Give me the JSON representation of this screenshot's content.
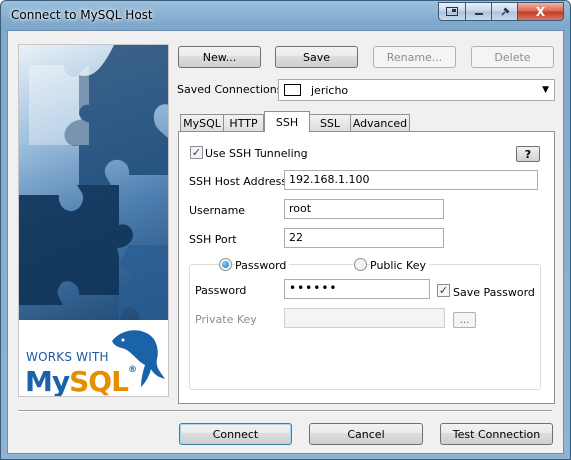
{
  "window": {
    "title": "Connect to MySQL Host",
    "controls": {
      "close_glyph": "X"
    }
  },
  "brand": {
    "works_with": "WORKS WITH",
    "logo_my": "My",
    "logo_sql": "SQL",
    "logo_reg": "®"
  },
  "toolbar": {
    "new_label": "New...",
    "save_label": "Save",
    "rename_label": "Rename...",
    "delete_label": "Delete"
  },
  "saved_connections": {
    "label": "Saved Connections",
    "value": "jericho"
  },
  "tabs": [
    "MySQL",
    "HTTP",
    "SSH",
    "SSL",
    "Advanced"
  ],
  "active_tab": "SSH",
  "ssh": {
    "use_tunneling_label": "Use SSH Tunneling",
    "use_tunneling_checked": true,
    "help_label": "?",
    "host_label": "SSH Host Address",
    "host_value": "192.168.1.100",
    "username_label": "Username",
    "username_value": "root",
    "port_label": "SSH Port",
    "port_value": "22",
    "auth": {
      "password_option": "Password",
      "public_key_option": "Public Key",
      "selected": "Password"
    },
    "password_label": "Password",
    "password_value": "••••••",
    "save_password_label": "Save Password",
    "save_password_checked": true,
    "private_key_label": "Private Key",
    "private_key_value": "",
    "browse_label": "..."
  },
  "footer": {
    "connect_label": "Connect",
    "cancel_label": "Cancel",
    "test_label": "Test Connection"
  }
}
